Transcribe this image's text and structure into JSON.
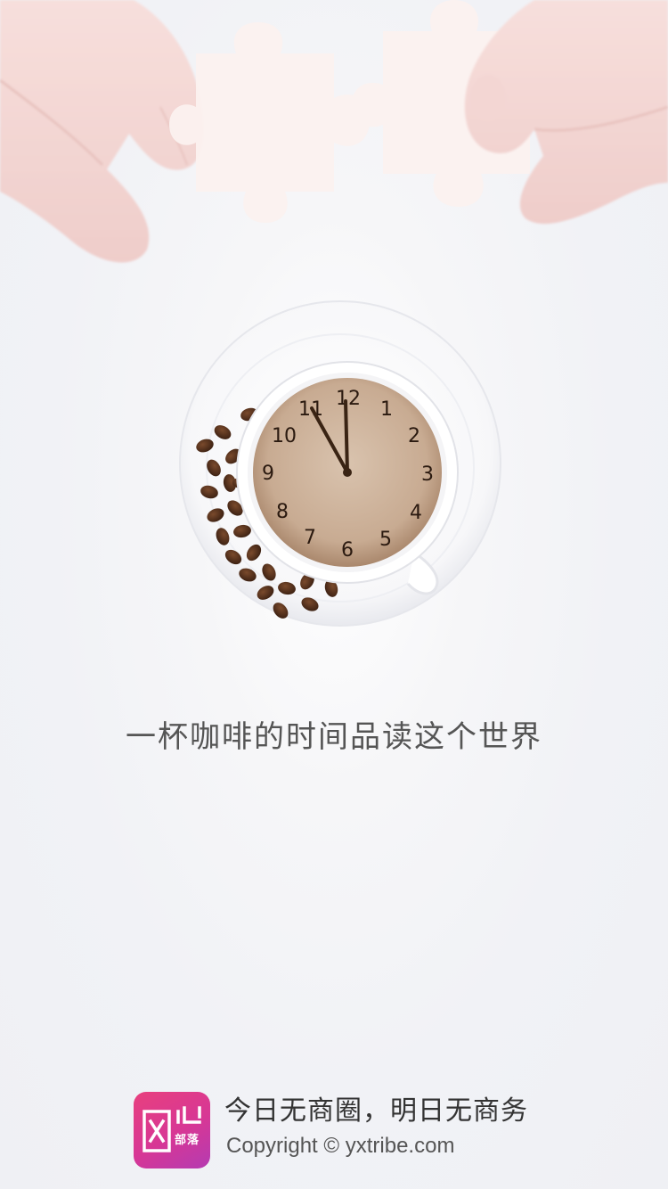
{
  "hero": {
    "illustration": "hands-holding-puzzle-pieces"
  },
  "clock": {
    "icon": "coffee-cup-clock-icon",
    "numbers": [
      "12",
      "1",
      "2",
      "3",
      "4",
      "5",
      "6",
      "7",
      "8",
      "9",
      "10",
      "11"
    ]
  },
  "tagline": "一杯咖啡的时间品读这个世界",
  "footer": {
    "logo_icon": "app-logo-icon",
    "slogan": "今日无商圈，明日无商务",
    "copyright": "Copyright © yxtribe.com"
  },
  "colors": {
    "background": "#f1f2f6",
    "logo_gradient_start": "#e8407e",
    "logo_gradient_end": "#b43bb2",
    "tagline": "#555555"
  }
}
